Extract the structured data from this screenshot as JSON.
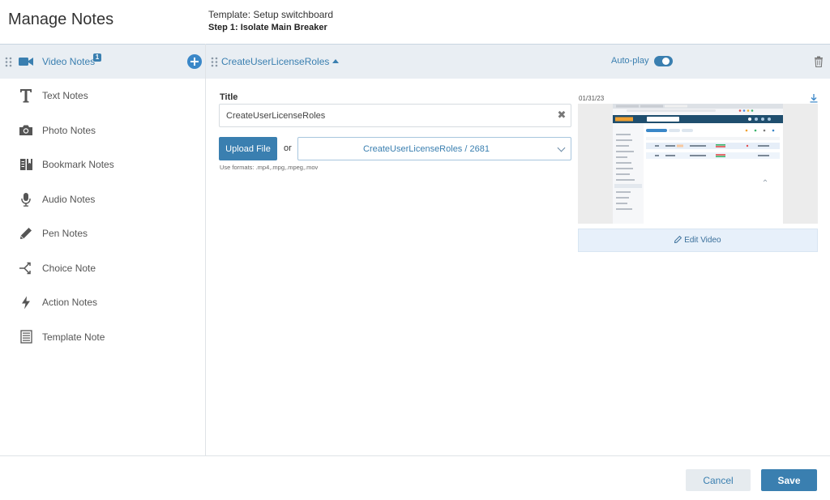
{
  "header": {
    "title": "Manage Notes",
    "template_line": "Template: Setup switchboard",
    "step_line": "Step 1: Isolate Main Breaker"
  },
  "sidebar": {
    "items": [
      {
        "label": "Video Notes",
        "icon": "video-camera-icon",
        "active": true,
        "badge": "1"
      },
      {
        "label": "Text Notes",
        "icon": "text-t-icon"
      },
      {
        "label": "Photo Notes",
        "icon": "camera-icon"
      },
      {
        "label": "Bookmark Notes",
        "icon": "bookmark-book-icon"
      },
      {
        "label": "Audio Notes",
        "icon": "microphone-icon"
      },
      {
        "label": "Pen Notes",
        "icon": "pencil-icon"
      },
      {
        "label": "Choice Note",
        "icon": "branch-arrows-icon"
      },
      {
        "label": "Action Notes",
        "icon": "lightning-bolt-icon"
      },
      {
        "label": "Template Note",
        "icon": "list-document-icon"
      }
    ]
  },
  "editor": {
    "note_title": "CreateUserLicenseRoles",
    "autoplay_label": "Auto-play",
    "autoplay_on": true,
    "title_label": "Title",
    "title_value": "CreateUserLicenseRoles",
    "upload_label": "Upload File",
    "or_label": "or",
    "select_value": "CreateUserLicenseRoles / 2681",
    "formats_text": "Use formats: .mp4,.mpg,.mpeg,.mov",
    "video_date": "01/31/23",
    "edit_video_label": "Edit Video"
  },
  "footer": {
    "cancel_label": "Cancel",
    "save_label": "Save"
  },
  "colors": {
    "accent": "#3a7fb0",
    "active_bg": "#e9eef3",
    "edit_bg": "#e7f0fa"
  }
}
